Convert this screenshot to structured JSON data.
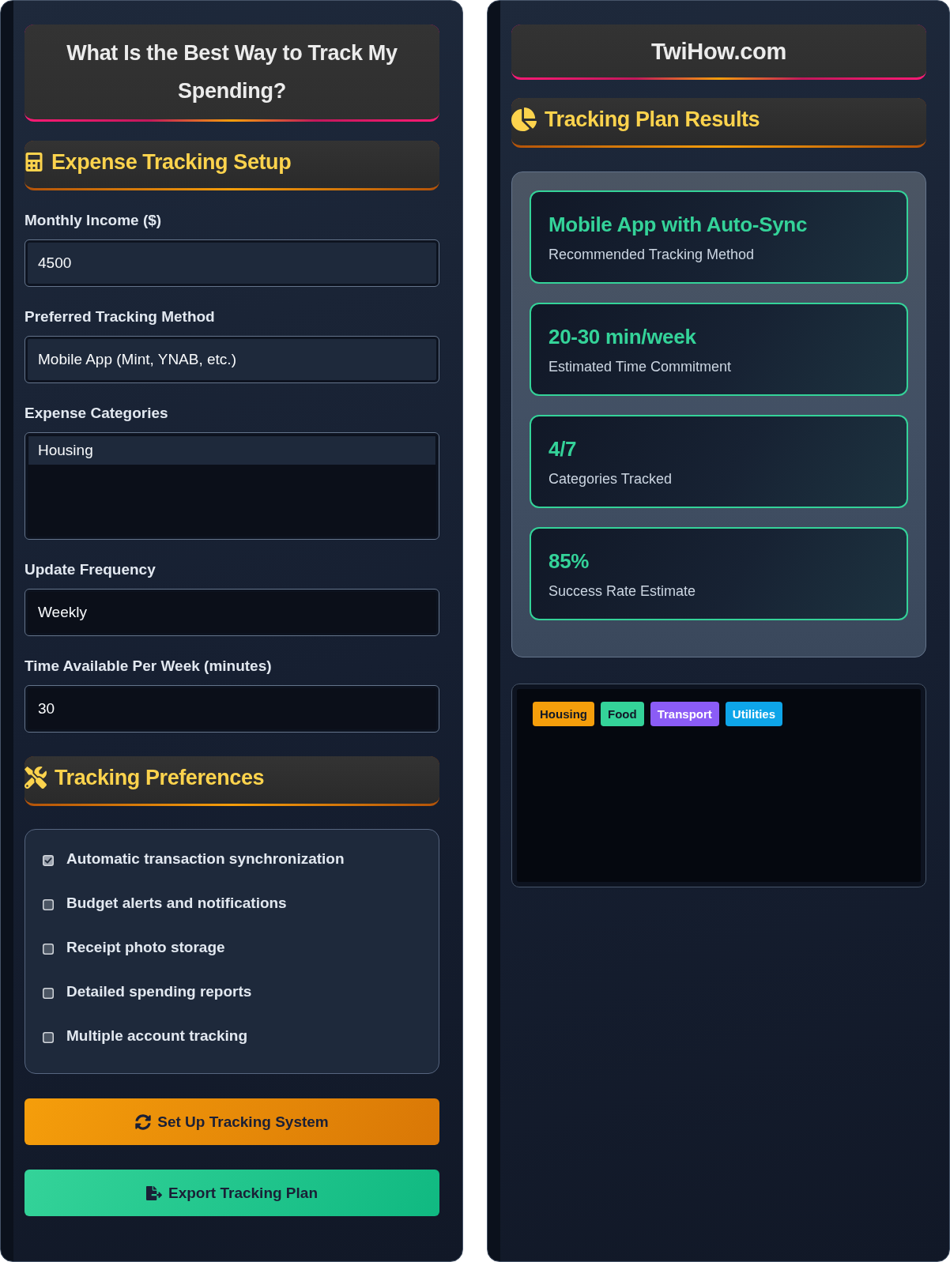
{
  "left_panel": {
    "title": "What Is the Best Way to Track My Spending?",
    "setup_section": {
      "heading": "Expense Tracking Setup",
      "fields": [
        {
          "kind": "input",
          "label": "Monthly Income ($)",
          "value": "4500"
        },
        {
          "kind": "select",
          "label": "Preferred Tracking Method",
          "value": "Mobile App (Mint, YNAB, etc.)"
        },
        {
          "kind": "listbox",
          "label": "Expense Categories",
          "options": [
            {
              "label": "Housing",
              "selected": true
            }
          ]
        },
        {
          "kind": "select",
          "label": "Update Frequency",
          "value": "Weekly"
        },
        {
          "kind": "input",
          "label": "Time Available Per Week (minutes)",
          "value": "30"
        }
      ]
    },
    "preferences_section": {
      "heading": "Tracking Preferences",
      "options": [
        {
          "label": "Automatic transaction synchronization",
          "checked": true
        },
        {
          "label": "Budget alerts and notifications",
          "checked": false
        },
        {
          "label": "Receipt photo storage",
          "checked": false
        },
        {
          "label": "Detailed spending reports",
          "checked": false
        },
        {
          "label": "Multiple account tracking",
          "checked": false
        }
      ]
    },
    "buttons": [
      {
        "kind": "primary",
        "label": "Set Up Tracking System"
      },
      {
        "kind": "success",
        "label": "Export Tracking Plan"
      }
    ]
  },
  "right_panel": {
    "site_title": "TwiHow.com",
    "results_section": {
      "heading": "Tracking Plan Results",
      "stats": [
        {
          "value": "Mobile App with Auto-Sync",
          "label": "Recommended Tracking Method"
        },
        {
          "value": "20-30 min/week",
          "label": "Estimated Time Commitment"
        },
        {
          "value": "4/7",
          "label": "Categories Tracked"
        },
        {
          "value": "85%",
          "label": "Success Rate Estimate"
        }
      ]
    },
    "category_tags": [
      {
        "label": "Housing",
        "color": "#f59e0b"
      },
      {
        "label": "Food",
        "color": "#34d399"
      },
      {
        "label": "Transport",
        "color": "#8b5cf6"
      },
      {
        "label": "Utilities",
        "color": "#0ea5e9"
      }
    ]
  }
}
